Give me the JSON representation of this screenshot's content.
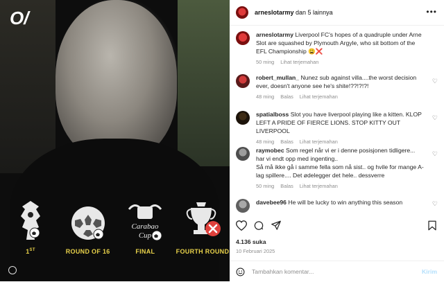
{
  "image": {
    "brand_logo": "O/",
    "trophies": [
      {
        "icon": "premier-league-lion-icon",
        "label_main": "1",
        "label_sup": "ST"
      },
      {
        "icon": "champions-league-ball-icon",
        "label_main": "ROUND OF 16",
        "label_sup": ""
      },
      {
        "icon": "carabao-cup-icon",
        "label_main": "FINAL",
        "label_sup": ""
      },
      {
        "icon": "fa-cup-icon",
        "label_main": "FOURTH ROUND",
        "label_sup": ""
      }
    ],
    "carabao_text_1": "Carabao",
    "carabao_text_2": "Cup"
  },
  "header": {
    "username": "arneslotarmy",
    "suffix": " dan 5 lainnya",
    "more_icon": "•••"
  },
  "comments": [
    {
      "user": "arneslotarmy",
      "text": "Liverpool FC's hopes of a quadruple under Arne Slot are squashed by Plymouth Argyle, who sit bottom of the EFL Championship 😩❌",
      "time": "50 ming",
      "reply": "",
      "translate": "Lihat terjemahan",
      "heart": false
    },
    {
      "user": "robert_mullan_",
      "text": "Nunez sub against villa....the worst decision ever, doesn't anyone see he's shite!??!?!?!",
      "time": "48 ming",
      "reply": "Balas",
      "translate": "Lihat terjemahan",
      "heart": true
    },
    {
      "user": "spatialboss",
      "text": "Slot you have liverpool playing like a kitten. KLOP LEFT A PRIDE OF FIERCE LIONS. STOP KITTY OUT LIVERPOOL",
      "time": "48 ming",
      "reply": "Balas",
      "translate": "Lihat terjemahan",
      "heart": true
    },
    {
      "user": "raymobec",
      "text": "Som regel når vi er i denne posisjonen tidligere... har vi endt opp med ingenting..\nSå må ikke gå i samme fella som nå sist.. og hvile for mange A-lag spillere.... Det ødelegger det hele.. dessverre",
      "time": "50 ming",
      "reply": "Balas",
      "translate": "Lihat terjemahan",
      "heart": true
    },
    {
      "user": "davebee96",
      "text": "He will be lucky to win anything this season",
      "time": "",
      "reply": "",
      "translate": "",
      "heart": true
    }
  ],
  "likes": "4.136 suka",
  "date": "10 Februari 2025",
  "comment_box": {
    "placeholder": "Tambahkan komentar...",
    "post_label": "Kirim"
  },
  "colors": {
    "trophy_label": "#e9d24a",
    "link_blue_disabled": "#b2dffc",
    "fa_cup_x": "#e0413c"
  }
}
